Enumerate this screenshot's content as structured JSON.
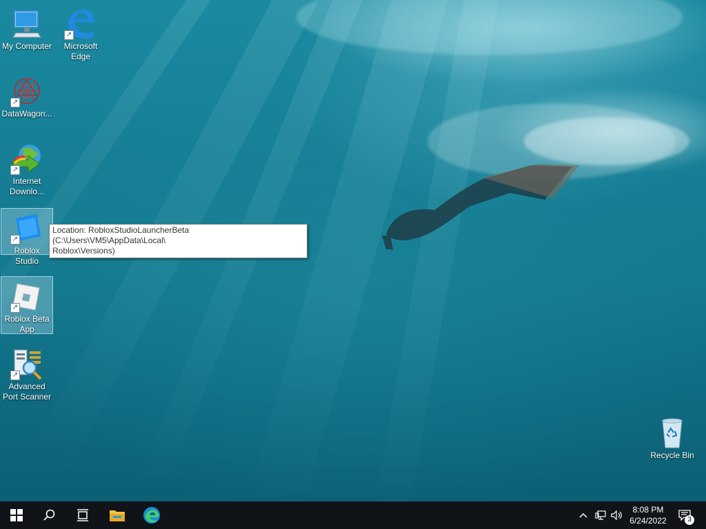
{
  "desktop": {
    "icons": [
      {
        "label": "My Computer"
      },
      {
        "label": "Microsoft Edge"
      },
      {
        "label": "DataWagon..."
      },
      {
        "label": "Internet Downlo..."
      },
      {
        "label": "Roblox Studio"
      },
      {
        "label": "Roblox Beta App"
      },
      {
        "label": "Advanced Port Scanner"
      },
      {
        "label": "Recycle Bin"
      }
    ],
    "tooltip": "Location: RobloxStudioLauncherBeta (C:\\Users\\VM5\\AppData\\Local\\\nRoblox\\Versions)"
  },
  "taskbar": {
    "time": "8:08 PM",
    "date": "6/24/2022",
    "notification_count": "3",
    "icons": [
      "windows-start-icon",
      "search-icon",
      "task-view-icon",
      "file-explorer-icon",
      "edge-icon"
    ],
    "tray_icons": [
      "chevron-up-icon",
      "network-icon",
      "volume-icon",
      "action-center-icon"
    ]
  },
  "colors": {
    "taskbar_bg": "#101418",
    "water_top": "#1a8aa0",
    "water_bottom": "#0c5f74",
    "accent_blue": "#0078d4"
  }
}
